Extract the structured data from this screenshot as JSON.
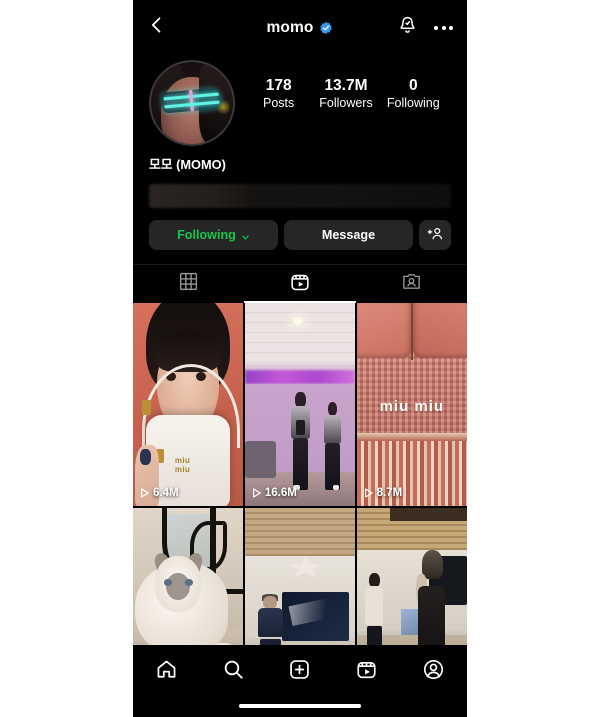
{
  "app": {
    "name": "Instagram",
    "screen": "profile"
  },
  "header": {
    "back_icon": "back-chevron-icon",
    "username": "momo",
    "verified": true,
    "verified_icon": "verified-badge-icon",
    "verified_color": "#3897f0",
    "notifications_icon": "bell-icon",
    "more_icon": "more-options-icon"
  },
  "profile": {
    "avatar_icon": "profile-avatar",
    "display_name": "모모 (MOMO)",
    "bio_redacted": true,
    "stats": [
      {
        "value": "178",
        "label": "Posts"
      },
      {
        "value": "13.7M",
        "label": "Followers"
      },
      {
        "value": "0",
        "label": "Following"
      }
    ]
  },
  "actions": {
    "following_label": "Following",
    "following_color": "#16c64b",
    "following_chevron_icon": "chevron-down-icon",
    "message_label": "Message",
    "add_person_icon": "add-person-icon"
  },
  "tabs": [
    {
      "name": "grid",
      "icon": "grid-icon",
      "active": false
    },
    {
      "name": "reels",
      "icon": "reels-icon",
      "active": true
    },
    {
      "name": "tagged",
      "icon": "tagged-icon",
      "active": false
    }
  ],
  "posts": [
    {
      "id": "post-1",
      "description": "Close-up portrait holding a white Miu Miu handbag on coral background",
      "brand_text": "miu\nmiu",
      "views": "6.4M",
      "views_icon": "play-icon",
      "has_views": true
    },
    {
      "id": "post-2",
      "description": "Dance practice room with purple neon lighting and two dancers",
      "views": "16.6M",
      "views_icon": "play-icon",
      "has_views": true
    },
    {
      "id": "post-3",
      "description": "Pink woven textile bag with miu miu logo and fringe",
      "brand_text": "miu miu",
      "views": "8.7M",
      "views_icon": "play-icon",
      "has_views": true
    },
    {
      "id": "post-4",
      "description": "Fluffy white ragdoll cat lying beside black ironwork railing",
      "views": "",
      "has_views": false
    },
    {
      "id": "post-5",
      "description": "Person in dark outfit dancing in a room with wood slat ceiling and TV",
      "views": "",
      "has_views": false
    },
    {
      "id": "post-6",
      "description": "Two people in a room with wood slat ceiling and a monitor",
      "views": "",
      "has_views": false
    }
  ],
  "bottom_nav": [
    {
      "name": "home",
      "icon": "home-icon"
    },
    {
      "name": "search",
      "icon": "search-icon"
    },
    {
      "name": "create",
      "icon": "create-plus-icon"
    },
    {
      "name": "reels",
      "icon": "reels-icon"
    },
    {
      "name": "profile",
      "icon": "profile-icon"
    }
  ],
  "system": {
    "home_indicator": "home-indicator"
  }
}
